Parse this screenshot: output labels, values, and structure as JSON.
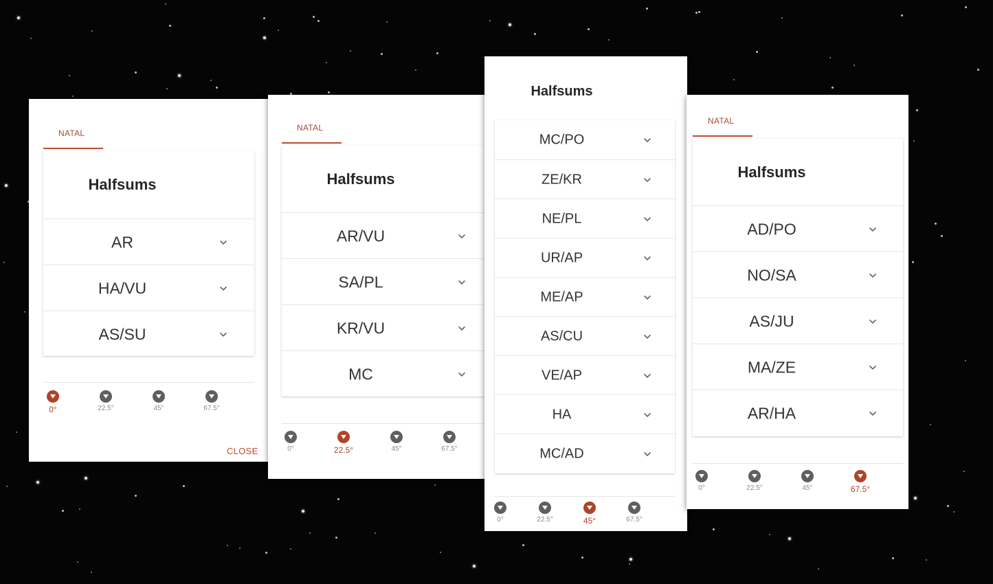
{
  "panel1": {
    "tab_label": "NATAL",
    "title": "Halfsums",
    "items": [
      "AR",
      "HA/VU",
      "AS/SU"
    ],
    "options": [
      "0°",
      "22.5°",
      "45°",
      "67.5°"
    ],
    "selected": 0,
    "close_label": "CLOSE"
  },
  "panel2": {
    "tab_label": "NATAL",
    "title": "Halfsums",
    "items": [
      "AR/VU",
      "SA/PL",
      "KR/VU",
      "MC"
    ],
    "options": [
      "0°",
      "22.5°",
      "45°",
      "67.5°"
    ],
    "selected": 1
  },
  "panel3": {
    "title": "Halfsums",
    "items": [
      "MC/PO",
      "ZE/KR",
      "NE/PL",
      "UR/AP",
      "ME/AP",
      "AS/CU",
      "VE/AP",
      "HA",
      "MC/AD"
    ],
    "options": [
      "0°",
      "22.5°",
      "45°",
      "67.5°"
    ],
    "selected": 2
  },
  "panel4": {
    "tab_label": "NATAL",
    "title": "Halfsums",
    "items": [
      "AD/PO",
      "NO/SA",
      "AS/JU",
      "MA/ZE",
      "AR/HA"
    ],
    "options": [
      "0°",
      "22.5°",
      "45°",
      "67.5°"
    ],
    "selected": 3
  },
  "icons": {
    "expand": "chevron-down-icon",
    "option": "caret-down-icon"
  },
  "colors": {
    "accent": "#b04428",
    "inactive": "#5f5f5f",
    "background": "#050505"
  }
}
